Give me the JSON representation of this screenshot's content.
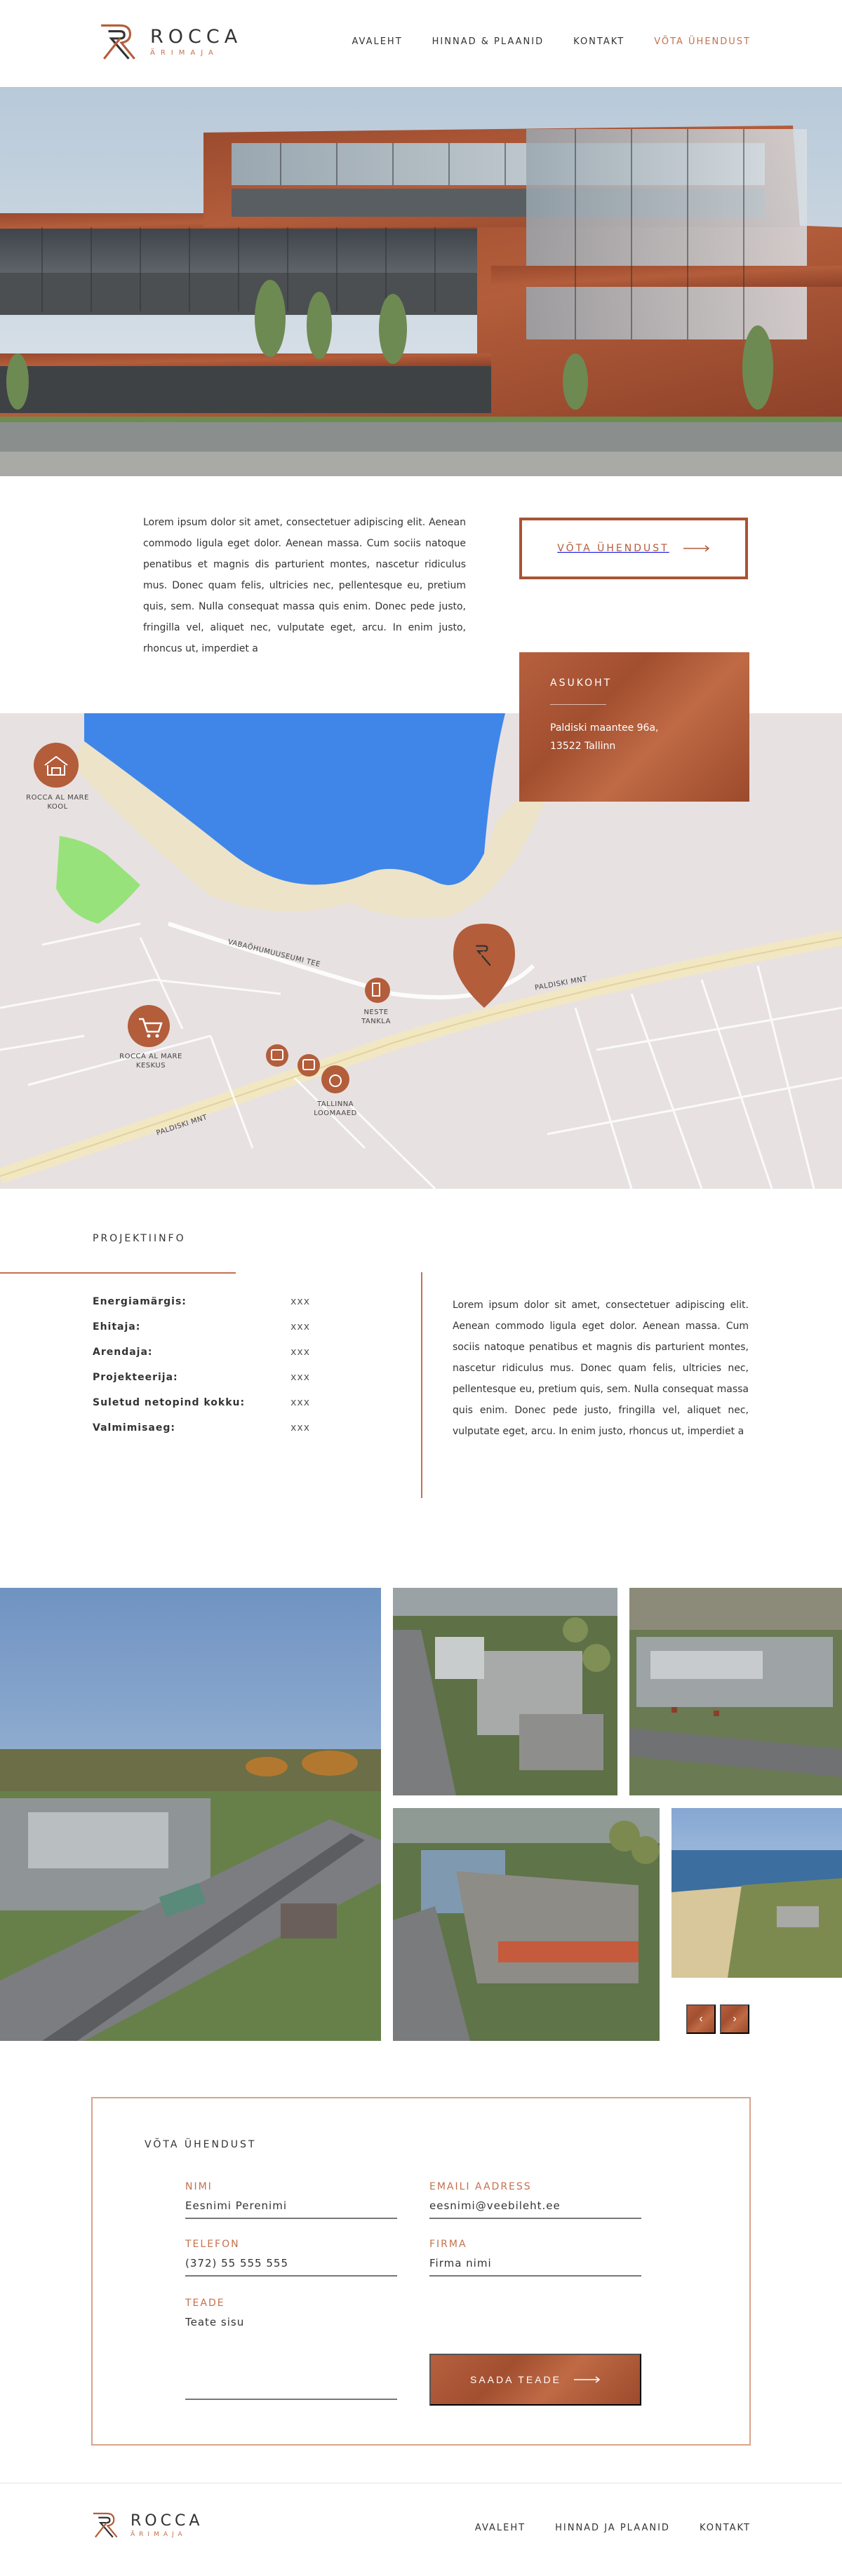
{
  "brand": {
    "name": "ROCCA",
    "sub": "ÄRIMAJA"
  },
  "nav": [
    {
      "label": "AVALEHT",
      "active": false
    },
    {
      "label": "HINNAD & PLAANID",
      "active": false
    },
    {
      "label": "KONTAKT",
      "active": false
    },
    {
      "label": "VÕTA ÜHENDUST",
      "active": true
    }
  ],
  "intro": {
    "text": "Lorem ipsum dolor sit amet, consectetuer adipiscing elit. Aenean commodo ligula eget dolor. Aenean massa. Cum sociis natoque penatibus et magnis dis parturient montes, nascetur ridiculus mus. Donec quam felis, ultricies nec, pellentesque eu, pretium quis, sem. Nulla consequat massa quis enim. Donec pede justo, fringilla vel, aliquet nec, vulputate eget, arcu. In enim justo, rhoncus ut, imperdiet a",
    "cta": "VÕTA ÜHENDUST"
  },
  "location": {
    "title": "ASUKOHT",
    "address_line1": "Paldiski maantee 96a,",
    "address_line2": "13522 Tallinn"
  },
  "map": {
    "labels": {
      "school_1": "ROCCA AL MARE",
      "school_2": "KOOL",
      "center_1": "ROCCA AL MARE",
      "center_2": "KESKUS",
      "station_1": "NESTE",
      "station_2": "TANKLA",
      "zoo_1": "TALLINNA",
      "zoo_2": "LOOMAAED",
      "road_museum": "VABAÕHUMUUSEUMI TEE",
      "road_paldiski_a": "PALDISKI MNT",
      "road_paldiski_b": "PALDISKI MNT"
    }
  },
  "project": {
    "title": "PROJEKTIINFO",
    "rows": [
      {
        "key": "Energiamärgis:",
        "value": "xxx"
      },
      {
        "key": "Ehitaja:",
        "value": "xxx"
      },
      {
        "key": "Arendaja:",
        "value": "xxx"
      },
      {
        "key": "Projekteerija:",
        "value": "xxx"
      },
      {
        "key": "Suletud netopind kokku:",
        "value": "xxx"
      },
      {
        "key": "Valmimisaeg:",
        "value": "xxx"
      }
    ],
    "text": "Lorem ipsum dolor sit amet, consectetuer adipiscing elit. Aenean commodo ligula eget dolor. Aenean massa. Cum sociis natoque penatibus et magnis dis parturient montes, nascetur ridiculus mus. Donec quam felis, ultricies nec, pellentesque eu, pretium quis, sem. Nulla consequat massa quis enim. Donec pede justo, fringilla vel, aliquet nec, vulputate eget, arcu. In enim justo, rhoncus ut, imperdiet a"
  },
  "gallery": {
    "prev": "‹",
    "next": "›"
  },
  "contact": {
    "title": "VÕTA ÜHENDUST",
    "name_label": "NIMI",
    "name_value": "Eesnimi Perenimi",
    "email_label": "EMAILI AADRESS",
    "email_value": "eesnimi@veebileht.ee",
    "phone_label": "TELEFON",
    "phone_value": "(372) 55 555 555",
    "company_label": "FIRMA",
    "company_value": "Firma nimi",
    "message_label": "TEADE",
    "message_value": "Teate sisu",
    "send": "SAADA TEADE"
  },
  "footer": {
    "nav": [
      "AVALEHT",
      "HINNAD JA PLAANID",
      "KONTAKT"
    ]
  },
  "colors": {
    "accent": "#c4714e",
    "copper": "#a85434"
  }
}
